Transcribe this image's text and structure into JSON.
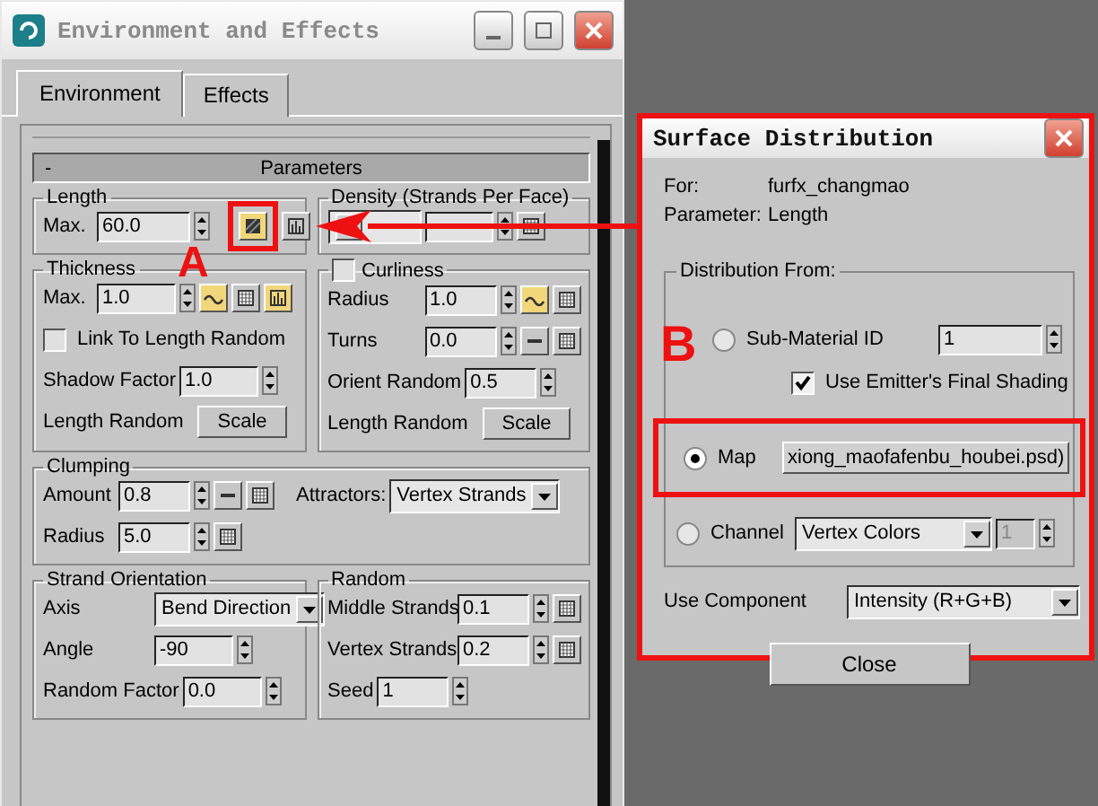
{
  "main_window": {
    "title": "Environment and Effects",
    "tabs": [
      {
        "label": "Environment",
        "selected": true
      },
      {
        "label": "Effects",
        "selected": false
      }
    ],
    "rollout": {
      "toggle": "-",
      "title": "Parameters"
    },
    "sections": [
      [
        {
          "title": "Length",
          "rows": [
            {
              "label": "Max.",
              "parts": [
                {
                  "kind": "spinner",
                  "value": "60.0"
                },
                {
                  "kind": "map",
                  "on": true
                },
                {
                  "kind": "bars",
                  "on": false
                }
              ]
            }
          ]
        },
        {
          "title": "Density (Strands Per Face)",
          "rows": [
            {
              "parts": [
                {
                  "kind": "dropdown"
                },
                {
                  "kind": "spinner"
                },
                {
                  "kind": "grid",
                  "on": false
                }
              ]
            }
          ]
        }
      ],
      [
        {
          "title": "Thickness",
          "rows": [
            {
              "label": "Max.",
              "parts": [
                {
                  "kind": "spinner",
                  "value": "1.0"
                },
                {
                  "kind": "wave",
                  "on": true
                },
                {
                  "kind": "grid",
                  "on": false
                },
                {
                  "kind": "bars",
                  "on": true
                }
              ]
            },
            {
              "parts": [
                {
                  "kind": "checkbox",
                  "label": "Link To Length Random",
                  "checked": false
                }
              ]
            },
            {
              "label": "Shadow Factor",
              "parts": [
                {
                  "kind": "spinner",
                  "value": "1.0"
                }
              ]
            },
            {
              "label": "Length Random",
              "parts": [
                {
                  "kind": "button",
                  "label": "Scale"
                }
              ]
            }
          ]
        },
        {
          "title": "Curliness",
          "checked": false,
          "rows": [
            {
              "label": "Radius",
              "parts": [
                {
                  "kind": "spinner",
                  "value": "1.0"
                },
                {
                  "kind": "wave",
                  "on": true
                },
                {
                  "kind": "grid",
                  "on": false
                }
              ]
            },
            {
              "label": "Turns",
              "parts": [
                {
                  "kind": "spinner",
                  "value": "0.0"
                },
                {
                  "kind": "dash",
                  "on": false
                },
                {
                  "kind": "grid",
                  "on": false
                }
              ]
            },
            {
              "label": "Orient Random",
              "parts": [
                {
                  "kind": "spinner",
                  "value": "0.5"
                }
              ]
            },
            {
              "label": "Length Random",
              "parts": [
                {
                  "kind": "button",
                  "label": "Scale"
                }
              ]
            }
          ]
        }
      ],
      [
        {
          "title": "Clumping",
          "rows": [
            {
              "label": "Amount",
              "parts": [
                {
                  "kind": "spinner",
                  "value": "0.8"
                },
                {
                  "kind": "dash",
                  "on": false
                },
                {
                  "kind": "grid",
                  "on": false
                },
                {
                  "kind": "text",
                  "value": "Attractors:"
                },
                {
                  "kind": "dropdown",
                  "value": "Vertex Strands"
                }
              ]
            },
            {
              "label": "Radius",
              "parts": [
                {
                  "kind": "spinner",
                  "value": "5.0"
                },
                {
                  "kind": "grid",
                  "on": false
                }
              ]
            }
          ]
        }
      ],
      [
        {
          "title": "Strand Orientation",
          "rows": [
            {
              "label": "Axis",
              "parts": [
                {
                  "kind": "dropdown",
                  "value": "Bend Direction"
                }
              ]
            },
            {
              "label": "Angle",
              "parts": [
                {
                  "kind": "spinner",
                  "value": "-90"
                }
              ]
            },
            {
              "label": "Random Factor",
              "parts": [
                {
                  "kind": "spinner",
                  "value": "0.0"
                }
              ]
            }
          ]
        },
        {
          "title": "Random",
          "rows": [
            {
              "label": "Middle Strands",
              "parts": [
                {
                  "kind": "spinner",
                  "value": "0.1"
                },
                {
                  "kind": "grid",
                  "on": false
                }
              ]
            },
            {
              "label": "Vertex Strands",
              "parts": [
                {
                  "kind": "spinner",
                  "value": "0.2"
                },
                {
                  "kind": "grid",
                  "on": false
                }
              ]
            },
            {
              "label": "Seed",
              "parts": [
                {
                  "kind": "spinner",
                  "value": "1"
                }
              ]
            }
          ]
        }
      ]
    ]
  },
  "dialog": {
    "title": "Surface Distribution",
    "info": [
      {
        "label": "For:",
        "value": "furfx_changmao"
      },
      {
        "label": "Parameter:",
        "value": "Length"
      }
    ],
    "group_title": "Distribution From:",
    "options": [
      {
        "kind": "spinner",
        "label": "Sub-Material ID",
        "selected": false,
        "value": "1",
        "checkbox": {
          "label": "Use Emitter's Final Shading",
          "checked": true
        }
      },
      {
        "kind": "map",
        "label": "Map",
        "selected": true,
        "value": "xiong_maofafenbu_houbei.psd)"
      },
      {
        "kind": "channel",
        "label": "Channel",
        "selected": false,
        "value": "Vertex Colors",
        "spinner": "1"
      }
    ],
    "component": {
      "label": "Use Component",
      "value": "Intensity (R+G+B)"
    },
    "close": "Close"
  },
  "annotations": [
    "A",
    "B"
  ]
}
